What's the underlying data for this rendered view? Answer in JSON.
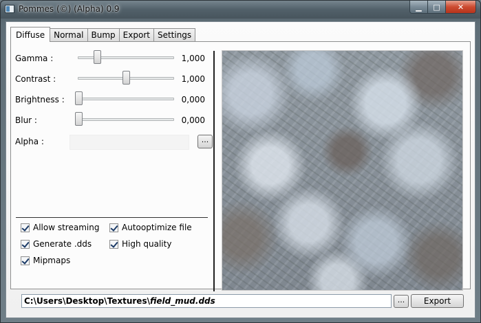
{
  "window": {
    "title": "Pommes (©) (Alpha) 0.9",
    "controls": {
      "minimize": "▁",
      "maximize": "□",
      "close": "✕"
    }
  },
  "tabs": [
    {
      "label": "Diffuse",
      "active": true
    },
    {
      "label": "Normal",
      "active": false
    },
    {
      "label": "Bump",
      "active": false
    },
    {
      "label": "Export",
      "active": false
    },
    {
      "label": "Settings",
      "active": false
    }
  ],
  "sliders": {
    "gamma": {
      "label": "Gamma :",
      "value": "1,000",
      "position": 0.2
    },
    "contrast": {
      "label": "Contrast :",
      "value": "1,000",
      "position": 0.5
    },
    "brightness": {
      "label": "Brightness :",
      "value": "0,000",
      "position": 0.0
    },
    "blur": {
      "label": "Blur :",
      "value": "0,000",
      "position": 0.0
    }
  },
  "alpha": {
    "label": "Alpha :",
    "browse_label": "..."
  },
  "options": {
    "allow_streaming": {
      "label": "Allow streaming",
      "checked": true
    },
    "generate_dds": {
      "label": "Generate .dds",
      "checked": true
    },
    "mipmaps": {
      "label": "Mipmaps",
      "checked": true
    },
    "autooptimize": {
      "label": "Autooptimize file",
      "checked": true
    },
    "high_quality": {
      "label": "High quality",
      "checked": true
    }
  },
  "output": {
    "path_prefix": "C:\\Users\\Desktop\\Textures\\",
    "path_file": "field_mud.dds",
    "browse_label": "...",
    "export_label": "Export"
  },
  "preview": {
    "image": "mud-rock-texture"
  }
}
